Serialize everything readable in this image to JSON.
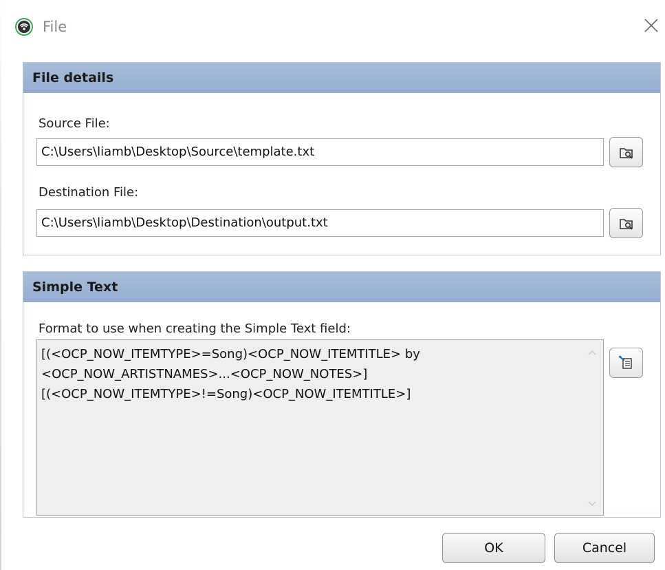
{
  "window": {
    "title": "File",
    "close_glyph": "✕"
  },
  "file_details": {
    "header": "File details",
    "source_label": "Source File:",
    "source_value": "C:\\Users\\liamb\\Desktop\\Source\\template.txt",
    "destination_label": "Destination File:",
    "destination_value": "C:\\Users\\liamb\\Desktop\\Destination\\output.txt"
  },
  "simple_text": {
    "header": "Simple Text",
    "format_label": "Format to use when creating the Simple Text field:",
    "format_lines": [
      "[(<OCP_NOW_ITEMTYPE>=Song)<OCP_NOW_ITEMTITLE> by",
      "<OCP_NOW_ARTISTNAMES>...<OCP_NOW_NOTES>]",
      "[(<OCP_NOW_ITEMTYPE>!=Song)<OCP_NOW_ITEMTITLE>]"
    ]
  },
  "buttons": {
    "ok": "OK",
    "cancel": "Cancel"
  },
  "icons": {
    "app": "broadcast-app-icon",
    "close": "close-icon",
    "browse": "folder-search-icon",
    "insert": "insert-field-icon"
  },
  "colors": {
    "group_header": "#9fb7d6",
    "app_icon_green": "#3aa85a"
  }
}
